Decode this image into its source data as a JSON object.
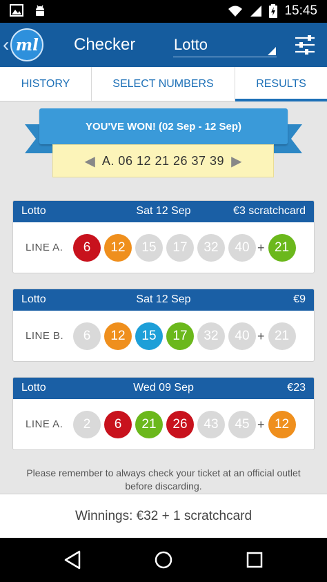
{
  "status_bar": {
    "time": "15:45"
  },
  "app_bar": {
    "logo_text": "ml",
    "title": "Checker",
    "game_selected": "Lotto"
  },
  "tabs": [
    {
      "label": "HISTORY",
      "active": false
    },
    {
      "label": "SELECT NUMBERS",
      "active": false
    },
    {
      "label": "RESULTS",
      "active": true
    }
  ],
  "banner": {
    "headline": "YOU'VE WON! (02 Sep - 12 Sep)",
    "numbers_line": "A. 06 12 21 26 37 39"
  },
  "results": [
    {
      "game": "Lotto",
      "date": "Sat 12 Sep",
      "prize": "€3 scratchcard",
      "line_label": "LINE A.",
      "balls": [
        {
          "n": "6",
          "c": "#c8121d"
        },
        {
          "n": "12",
          "c": "#ef8f1d"
        },
        {
          "n": "15",
          "c": "grey"
        },
        {
          "n": "17",
          "c": "grey"
        },
        {
          "n": "32",
          "c": "grey"
        },
        {
          "n": "40",
          "c": "grey"
        }
      ],
      "bonus": {
        "n": "21",
        "c": "#6bb81c"
      }
    },
    {
      "game": "Lotto",
      "date": "Sat 12 Sep",
      "prize": "€9",
      "line_label": "LINE B.",
      "balls": [
        {
          "n": "6",
          "c": "grey"
        },
        {
          "n": "12",
          "c": "#ef8f1d"
        },
        {
          "n": "15",
          "c": "#1d9fd8"
        },
        {
          "n": "17",
          "c": "#6bb81c"
        },
        {
          "n": "32",
          "c": "grey"
        },
        {
          "n": "40",
          "c": "grey"
        }
      ],
      "bonus": {
        "n": "21",
        "c": "grey"
      }
    },
    {
      "game": "Lotto",
      "date": "Wed 09 Sep",
      "prize": "€23",
      "line_label": "LINE A.",
      "balls": [
        {
          "n": "2",
          "c": "grey"
        },
        {
          "n": "6",
          "c": "#c8121d"
        },
        {
          "n": "21",
          "c": "#6bb81c"
        },
        {
          "n": "26",
          "c": "#c8121d"
        },
        {
          "n": "43",
          "c": "grey"
        },
        {
          "n": "45",
          "c": "grey"
        }
      ],
      "bonus": {
        "n": "12",
        "c": "#ef8f1d"
      }
    }
  ],
  "notice": "Please remember to always check your ticket at an official outlet before discarding.",
  "winnings": "Winnings: €32 + 1 scratchcard",
  "icons": {
    "status_left": [
      "image-icon",
      "android-icon"
    ],
    "status_right": [
      "wifi-icon",
      "signal-icon",
      "battery-charging-icon"
    ],
    "app_bar": [
      "back-chevron-icon",
      "filter-sliders-icon"
    ],
    "nav": [
      "back-triangle-icon",
      "home-circle-icon",
      "recents-square-icon"
    ]
  }
}
